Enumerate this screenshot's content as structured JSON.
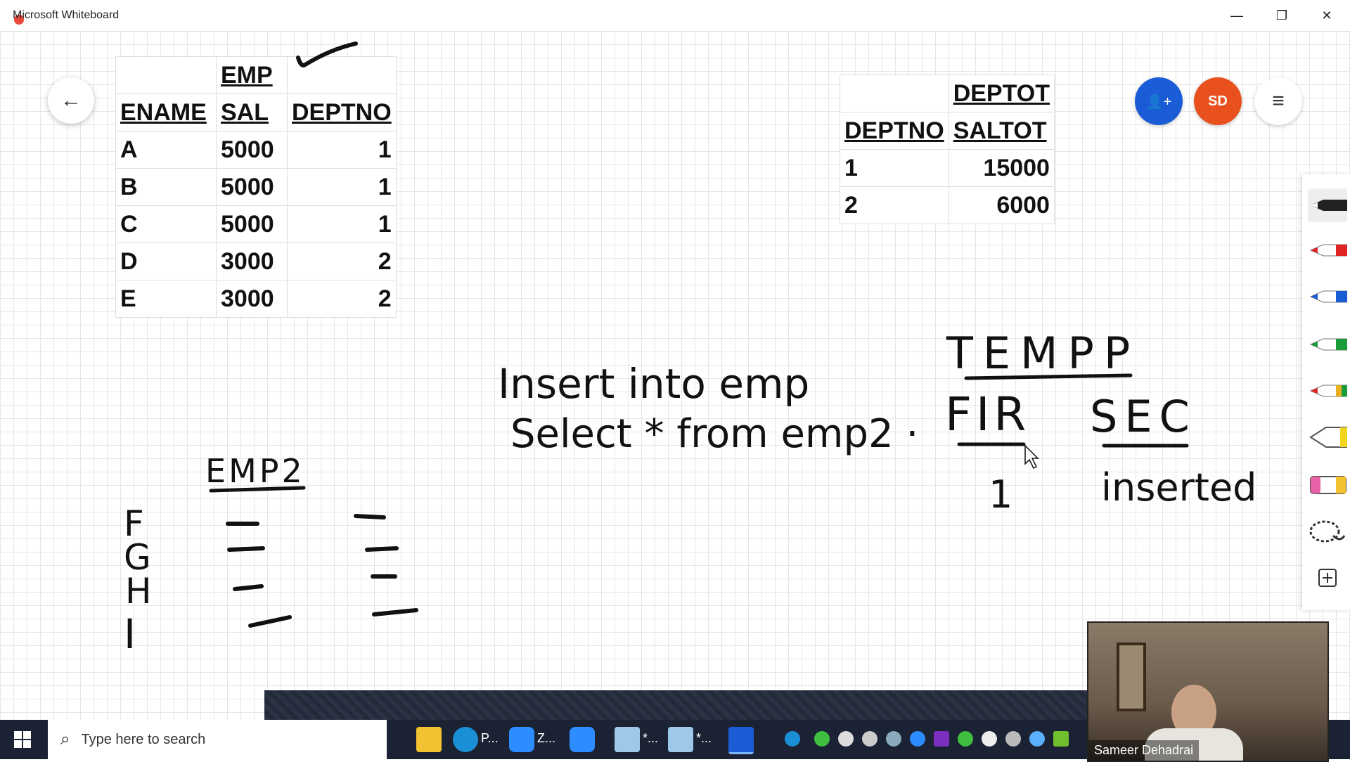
{
  "window": {
    "title": "Microsoft Whiteboard",
    "minimize": "—",
    "restore": "❐",
    "close": "✕"
  },
  "top_buttons": {
    "back": "←",
    "invite": "👤+",
    "avatar": "SD",
    "menu": "≡"
  },
  "colors": {
    "invite": "#1a5bd6",
    "avatar": "#e8501e",
    "taskbar": "#1b2233"
  },
  "emp_table": {
    "title": "EMP",
    "headers": [
      "ENAME",
      "SAL",
      "DEPTNO"
    ],
    "rows": [
      [
        "A",
        "5000",
        "1"
      ],
      [
        "B",
        "5000",
        "1"
      ],
      [
        "C",
        "5000",
        "1"
      ],
      [
        "D",
        "3000",
        "2"
      ],
      [
        "E",
        "3000",
        "2"
      ]
    ]
  },
  "deptot_table": {
    "title": "DEPTOT",
    "headers": [
      "DEPTNO",
      "SALTOT"
    ],
    "rows": [
      [
        "1",
        "15000"
      ],
      [
        "2",
        "6000"
      ]
    ]
  },
  "handwriting": {
    "line1": "Insert into emp",
    "line2": "Select * from emp2 ·",
    "emp2": "EMP2",
    "rows": [
      "F",
      "G",
      "H",
      "I"
    ],
    "tempp": "TEMPP",
    "fir": "FIR",
    "sec": "SEC",
    "fir_value": "1",
    "sec_value": "inserted"
  },
  "toolbar": {
    "tools": [
      "pen-black",
      "pen-red",
      "pen-blue",
      "pen-green",
      "pen-rainbow",
      "highlighter",
      "eraser",
      "lasso",
      "add"
    ]
  },
  "taskbar": {
    "search_placeholder": "Type here to search",
    "apps": [
      "P...",
      "Z...",
      "*...",
      "*..."
    ]
  },
  "video": {
    "name": "Sameer Dehadrai"
  }
}
